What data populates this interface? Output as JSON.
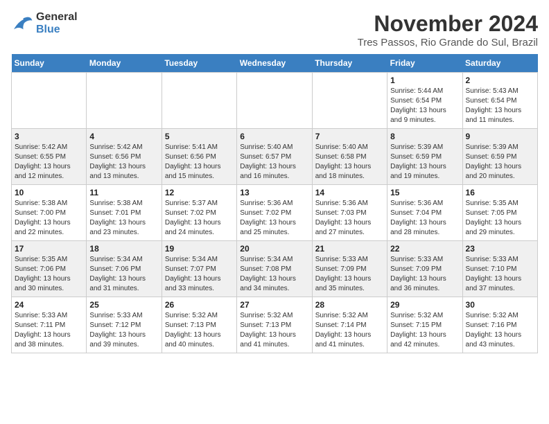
{
  "header": {
    "logo_line1": "General",
    "logo_line2": "Blue",
    "month_title": "November 2024",
    "location": "Tres Passos, Rio Grande do Sul, Brazil"
  },
  "calendar": {
    "days_of_week": [
      "Sunday",
      "Monday",
      "Tuesday",
      "Wednesday",
      "Thursday",
      "Friday",
      "Saturday"
    ],
    "weeks": [
      [
        {
          "day": "",
          "info": ""
        },
        {
          "day": "",
          "info": ""
        },
        {
          "day": "",
          "info": ""
        },
        {
          "day": "",
          "info": ""
        },
        {
          "day": "",
          "info": ""
        },
        {
          "day": "1",
          "info": "Sunrise: 5:44 AM\nSunset: 6:54 PM\nDaylight: 13 hours\nand 9 minutes."
        },
        {
          "day": "2",
          "info": "Sunrise: 5:43 AM\nSunset: 6:54 PM\nDaylight: 13 hours\nand 11 minutes."
        }
      ],
      [
        {
          "day": "3",
          "info": "Sunrise: 5:42 AM\nSunset: 6:55 PM\nDaylight: 13 hours\nand 12 minutes."
        },
        {
          "day": "4",
          "info": "Sunrise: 5:42 AM\nSunset: 6:56 PM\nDaylight: 13 hours\nand 13 minutes."
        },
        {
          "day": "5",
          "info": "Sunrise: 5:41 AM\nSunset: 6:56 PM\nDaylight: 13 hours\nand 15 minutes."
        },
        {
          "day": "6",
          "info": "Sunrise: 5:40 AM\nSunset: 6:57 PM\nDaylight: 13 hours\nand 16 minutes."
        },
        {
          "day": "7",
          "info": "Sunrise: 5:40 AM\nSunset: 6:58 PM\nDaylight: 13 hours\nand 18 minutes."
        },
        {
          "day": "8",
          "info": "Sunrise: 5:39 AM\nSunset: 6:59 PM\nDaylight: 13 hours\nand 19 minutes."
        },
        {
          "day": "9",
          "info": "Sunrise: 5:39 AM\nSunset: 6:59 PM\nDaylight: 13 hours\nand 20 minutes."
        }
      ],
      [
        {
          "day": "10",
          "info": "Sunrise: 5:38 AM\nSunset: 7:00 PM\nDaylight: 13 hours\nand 22 minutes."
        },
        {
          "day": "11",
          "info": "Sunrise: 5:38 AM\nSunset: 7:01 PM\nDaylight: 13 hours\nand 23 minutes."
        },
        {
          "day": "12",
          "info": "Sunrise: 5:37 AM\nSunset: 7:02 PM\nDaylight: 13 hours\nand 24 minutes."
        },
        {
          "day": "13",
          "info": "Sunrise: 5:36 AM\nSunset: 7:02 PM\nDaylight: 13 hours\nand 25 minutes."
        },
        {
          "day": "14",
          "info": "Sunrise: 5:36 AM\nSunset: 7:03 PM\nDaylight: 13 hours\nand 27 minutes."
        },
        {
          "day": "15",
          "info": "Sunrise: 5:36 AM\nSunset: 7:04 PM\nDaylight: 13 hours\nand 28 minutes."
        },
        {
          "day": "16",
          "info": "Sunrise: 5:35 AM\nSunset: 7:05 PM\nDaylight: 13 hours\nand 29 minutes."
        }
      ],
      [
        {
          "day": "17",
          "info": "Sunrise: 5:35 AM\nSunset: 7:06 PM\nDaylight: 13 hours\nand 30 minutes."
        },
        {
          "day": "18",
          "info": "Sunrise: 5:34 AM\nSunset: 7:06 PM\nDaylight: 13 hours\nand 31 minutes."
        },
        {
          "day": "19",
          "info": "Sunrise: 5:34 AM\nSunset: 7:07 PM\nDaylight: 13 hours\nand 33 minutes."
        },
        {
          "day": "20",
          "info": "Sunrise: 5:34 AM\nSunset: 7:08 PM\nDaylight: 13 hours\nand 34 minutes."
        },
        {
          "day": "21",
          "info": "Sunrise: 5:33 AM\nSunset: 7:09 PM\nDaylight: 13 hours\nand 35 minutes."
        },
        {
          "day": "22",
          "info": "Sunrise: 5:33 AM\nSunset: 7:09 PM\nDaylight: 13 hours\nand 36 minutes."
        },
        {
          "day": "23",
          "info": "Sunrise: 5:33 AM\nSunset: 7:10 PM\nDaylight: 13 hours\nand 37 minutes."
        }
      ],
      [
        {
          "day": "24",
          "info": "Sunrise: 5:33 AM\nSunset: 7:11 PM\nDaylight: 13 hours\nand 38 minutes."
        },
        {
          "day": "25",
          "info": "Sunrise: 5:33 AM\nSunset: 7:12 PM\nDaylight: 13 hours\nand 39 minutes."
        },
        {
          "day": "26",
          "info": "Sunrise: 5:32 AM\nSunset: 7:13 PM\nDaylight: 13 hours\nand 40 minutes."
        },
        {
          "day": "27",
          "info": "Sunrise: 5:32 AM\nSunset: 7:13 PM\nDaylight: 13 hours\nand 41 minutes."
        },
        {
          "day": "28",
          "info": "Sunrise: 5:32 AM\nSunset: 7:14 PM\nDaylight: 13 hours\nand 41 minutes."
        },
        {
          "day": "29",
          "info": "Sunrise: 5:32 AM\nSunset: 7:15 PM\nDaylight: 13 hours\nand 42 minutes."
        },
        {
          "day": "30",
          "info": "Sunrise: 5:32 AM\nSunset: 7:16 PM\nDaylight: 13 hours\nand 43 minutes."
        }
      ]
    ]
  }
}
